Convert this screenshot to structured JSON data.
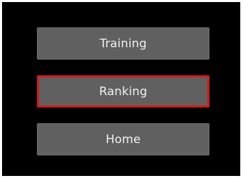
{
  "menu": {
    "items": [
      {
        "label": "Training",
        "selected": false
      },
      {
        "label": "Ranking",
        "selected": true
      },
      {
        "label": "Home",
        "selected": false
      }
    ]
  },
  "colors": {
    "background": "#000000",
    "button": "#606060",
    "button_text": "#f2f2f2",
    "selection_outline": "#d61818"
  }
}
